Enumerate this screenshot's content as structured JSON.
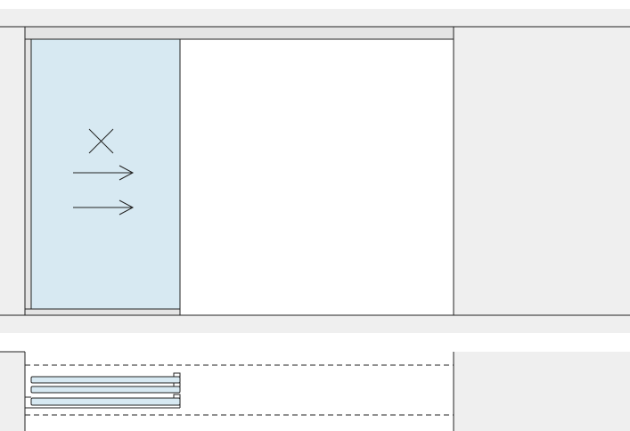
{
  "drawing": {
    "colors": {
      "wall_fill": "#efefef",
      "glass_fill": "#d7e9f2",
      "frame_fill": "#e4e4e4",
      "line": "#222222",
      "background": "#ffffff"
    },
    "elevation_view": {
      "panel_count": 1,
      "symbols": [
        "fixed-cross-icon",
        "slide-arrow-icon",
        "slide-arrow-icon"
      ]
    },
    "plan_view": {
      "stacked_panel_count": 3,
      "track_style": "dashed"
    }
  }
}
